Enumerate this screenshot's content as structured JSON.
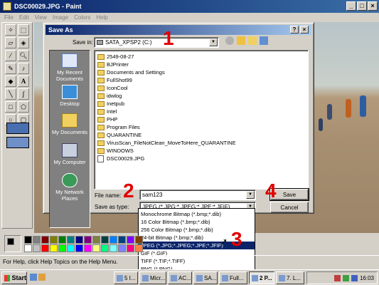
{
  "window": {
    "title": "DSC00029.JPG - Paint"
  },
  "menu": [
    "File",
    "Edit",
    "View",
    "Image",
    "Colors",
    "Help"
  ],
  "dialog": {
    "title": "Save As",
    "save_in_label": "Save in:",
    "save_in_value": "SATA_XPSP2 (C:)",
    "places": [
      "My Recent Documents",
      "Desktop",
      "My Documents",
      "My Computer",
      "My Network Places"
    ],
    "files": [
      "2549-08-27",
      "BJPrinter",
      "Documents and Settings",
      "FullShot99",
      "IconCool",
      "idwlog",
      "Inetpub",
      "Intel",
      "PHP",
      "Program Files",
      "QUARANTINE",
      "VirusScan_FileNotClean_MoveToHere_QUARANTINE",
      "WINDOWS",
      "DSC00029.JPG"
    ],
    "file_name_label": "File name:",
    "file_name_value": "sam123",
    "save_type_label": "Save as type:",
    "save_type_value": "JPEG (*.JPG;*.JPEG;*.JPE;*.JFIF)",
    "save_button": "Save",
    "cancel_button": "Cancel",
    "type_options": [
      "Monochrome Bitmap (*.bmp;*.dib)",
      "16 Color Bitmap (*.bmp;*.dib)",
      "256 Color Bitmap (*.bmp;*.dib)",
      "24-bit Bitmap (*.bmp;*.dib)",
      "JPEG (*.JPG;*.JPEG;*.JPE;*.JFIF)",
      "GIF (*.GIF)",
      "TIFF (*.TIF;*.TIFF)",
      "PNG (*.PNG)"
    ],
    "selected_type_index": 4
  },
  "markers": [
    "1",
    "2",
    "3",
    "4"
  ],
  "statusbar": {
    "text": "For Help, click Help Topics on the Help Menu."
  },
  "taskbar": {
    "start": "Start",
    "tasks": [
      "5 I...",
      "Micr...",
      "AC...",
      "SA...",
      "Full...",
      "2 P...",
      "7. L..."
    ],
    "clock": "16:03"
  },
  "palette_colors": [
    "#000000",
    "#808080",
    "#800000",
    "#808000",
    "#008000",
    "#008080",
    "#000080",
    "#800080",
    "#808040",
    "#004040",
    "#0080ff",
    "#004080",
    "#8000ff",
    "#804000",
    "#ffffff",
    "#c0c0c0",
    "#ff0000",
    "#ffff00",
    "#00ff00",
    "#00ffff",
    "#0000ff",
    "#ff00ff",
    "#ffff80",
    "#00ff80",
    "#80ffff",
    "#8080ff",
    "#ff0080",
    "#ff8040"
  ],
  "colors": {
    "marker": "#e00000",
    "title_bar": "#0a246a",
    "selection": "#0a246a"
  }
}
